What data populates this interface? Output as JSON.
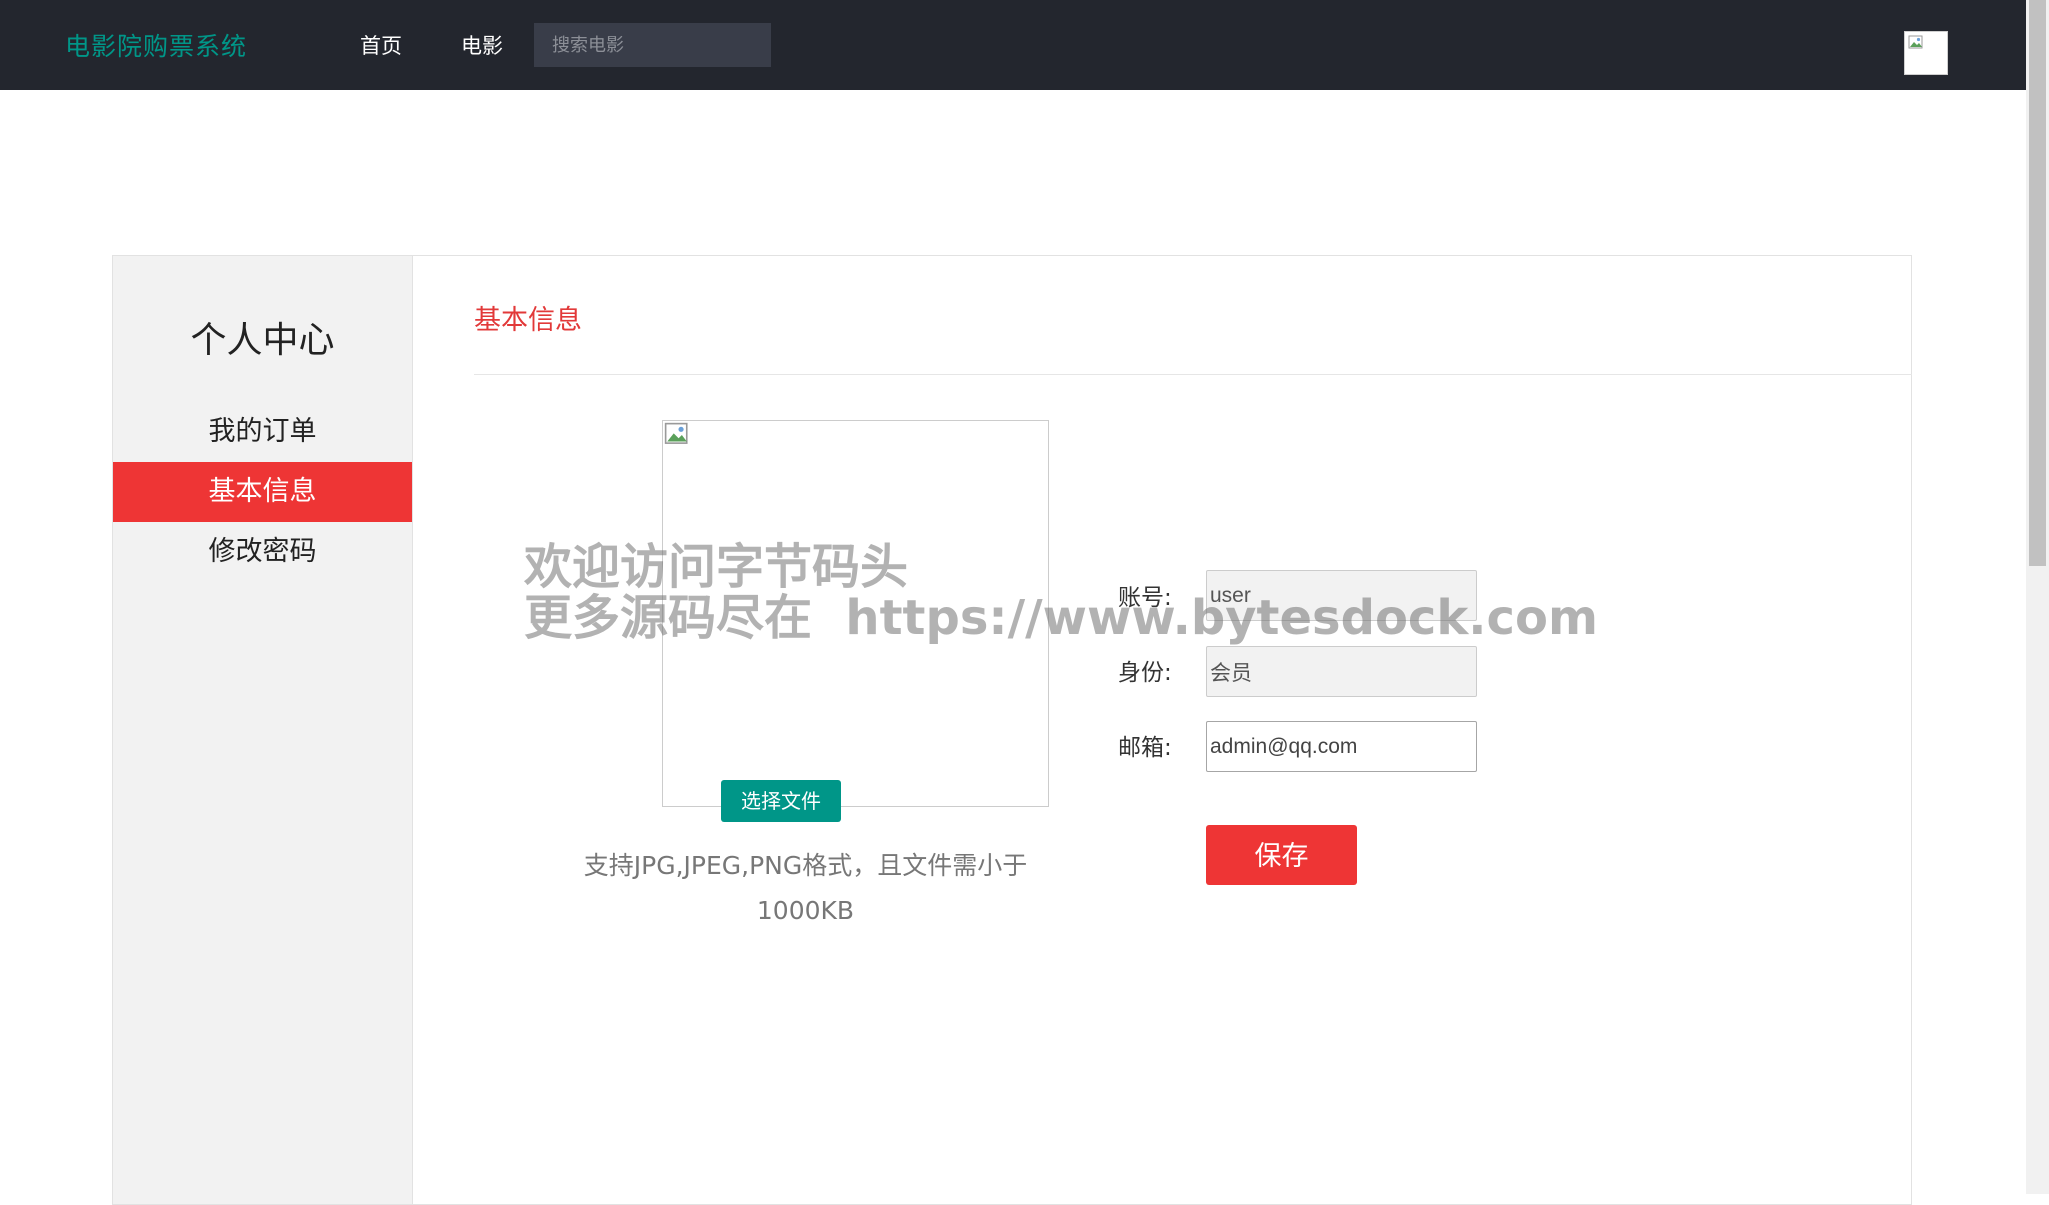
{
  "header": {
    "brand": "电影院购票系统",
    "nav": {
      "home": "首页",
      "movies": "电影"
    },
    "search": {
      "placeholder": "搜索电影",
      "value": ""
    }
  },
  "sidebar": {
    "title": "个人中心",
    "items": [
      {
        "label": "我的订单",
        "active": false
      },
      {
        "label": "基本信息",
        "active": true
      },
      {
        "label": "修改密码",
        "active": false
      }
    ]
  },
  "main": {
    "section_title": "基本信息",
    "upload": {
      "button_label": "选择文件",
      "hint": "支持JPG,JPEG,PNG格式，且文件需小于1000KB"
    },
    "form": {
      "account_label": "账号:",
      "account_value": "user",
      "role_label": "身份:",
      "role_value": "会员",
      "email_label": "邮箱:",
      "email_value": "admin@qq.com",
      "save_label": "保存"
    }
  },
  "watermark": {
    "line1": "欢迎访问字节码头",
    "line2": "更多源码尽在  https://www.bytesdock.com"
  },
  "colors": {
    "topbar": "#23262e",
    "brand": "#009688",
    "accent_red": "#ee3535",
    "sidebar_bg": "#f2f2f2"
  },
  "icons": {
    "avatar": "broken-image-icon",
    "photo": "broken-image-icon"
  }
}
